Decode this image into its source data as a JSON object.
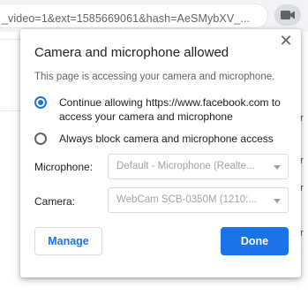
{
  "browser": {
    "url_fragment": "_video=1&ext=1585669061&hash=AeSMybXV_...",
    "camera_indicator_icon": "video-camera-icon"
  },
  "background": {
    "letters": [
      "r",
      "r",
      "r",
      "r"
    ]
  },
  "popup": {
    "title": "Camera and microphone allowed",
    "subtitle": "This page is accessing your camera and microphone.",
    "options": [
      {
        "label_line1": "Continue allowing https://www.facebook.com to",
        "label_line2": "access your camera and microphone",
        "checked": true
      },
      {
        "label_line1": "Always block camera and microphone access",
        "label_line2": "",
        "checked": false
      }
    ],
    "microphone": {
      "label": "Microphone:",
      "value": "Default - Microphone (Realte..."
    },
    "camera": {
      "label": "Camera:",
      "value": "WebCam SCB-0350M (1210:..."
    },
    "manage_label": "Manage",
    "done_label": "Done",
    "close_glyph": "✕"
  },
  "colors": {
    "accent": "#1a73e8",
    "muted_text": "#5f6368"
  }
}
